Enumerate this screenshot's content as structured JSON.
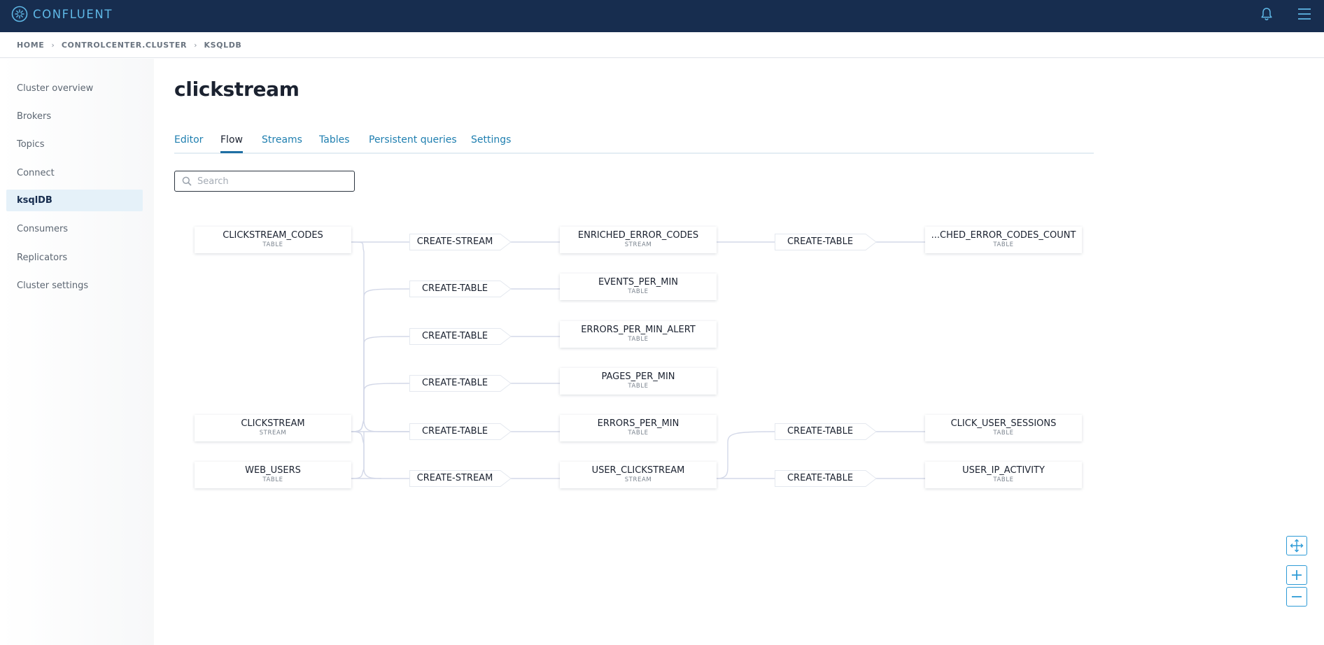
{
  "brand": {
    "name": "CONFLUENT"
  },
  "icons": {
    "logo": "confluent-logo-icon",
    "notifications": "bell-icon",
    "menu": "hamburger-menu-icon",
    "search": "search-icon",
    "fit": "fit-to-screen-icon",
    "zoom_in": "plus-icon",
    "zoom_out": "minus-icon",
    "breadcrumb_separator": "chevron-right-icon"
  },
  "breadcrumb": [
    {
      "label": "HOME"
    },
    {
      "label": "CONTROLCENTER.CLUSTER"
    },
    {
      "label": "KSQLDB"
    }
  ],
  "sidebar": {
    "active": "ksqlDB",
    "items": [
      {
        "label": "Cluster overview"
      },
      {
        "label": "Brokers"
      },
      {
        "label": "Topics"
      },
      {
        "label": "Connect"
      },
      {
        "label": "ksqlDB"
      },
      {
        "label": "Consumers"
      },
      {
        "label": "Replicators"
      },
      {
        "label": "Cluster settings"
      }
    ]
  },
  "main": {
    "title": "clickstream",
    "active_tab": "Flow",
    "tabs": [
      {
        "label": "Editor"
      },
      {
        "label": "Flow"
      },
      {
        "label": "Streams"
      },
      {
        "label": "Tables"
      },
      {
        "label": "Persistent queries"
      },
      {
        "label": "Settings"
      }
    ],
    "search": {
      "placeholder": "Search",
      "value": ""
    }
  },
  "flow": {
    "sources": [
      {
        "name": "CLICKSTREAM_CODES",
        "type": "TABLE"
      },
      {
        "name": "CLICKSTREAM",
        "type": "STREAM"
      },
      {
        "name": "WEB_USERS",
        "type": "TABLE"
      }
    ],
    "operations": [
      {
        "label": "CREATE-STREAM"
      },
      {
        "label": "CREATE-TABLE"
      },
      {
        "label": "CREATE-TABLE"
      },
      {
        "label": "CREATE-TABLE"
      },
      {
        "label": "CREATE-TABLE"
      },
      {
        "label": "CREATE-STREAM"
      },
      {
        "label": "CREATE-TABLE"
      },
      {
        "label": "CREATE-TABLE"
      },
      {
        "label": "CREATE-TABLE"
      }
    ],
    "derived": [
      {
        "name": "ENRICHED_ERROR_CODES",
        "type": "STREAM"
      },
      {
        "name": "EVENTS_PER_MIN",
        "type": "TABLE"
      },
      {
        "name": "ERRORS_PER_MIN_ALERT",
        "type": "TABLE"
      },
      {
        "name": "PAGES_PER_MIN",
        "type": "TABLE"
      },
      {
        "name": "ERRORS_PER_MIN",
        "type": "TABLE"
      },
      {
        "name": "USER_CLICKSTREAM",
        "type": "STREAM"
      },
      {
        "name": "...CHED_ERROR_CODES_COUNT",
        "type": "TABLE"
      },
      {
        "name": "CLICK_USER_SESSIONS",
        "type": "TABLE"
      },
      {
        "name": "USER_IP_ACTIVITY",
        "type": "TABLE"
      }
    ]
  },
  "colors": {
    "topbar": "#172d4f",
    "brand_accent": "#5fb8e6",
    "link": "#1f7fb0",
    "active_nav_bg": "#e5f1f9",
    "edge": "#d3d8e8",
    "zoom_control": "#2e9bd6"
  }
}
